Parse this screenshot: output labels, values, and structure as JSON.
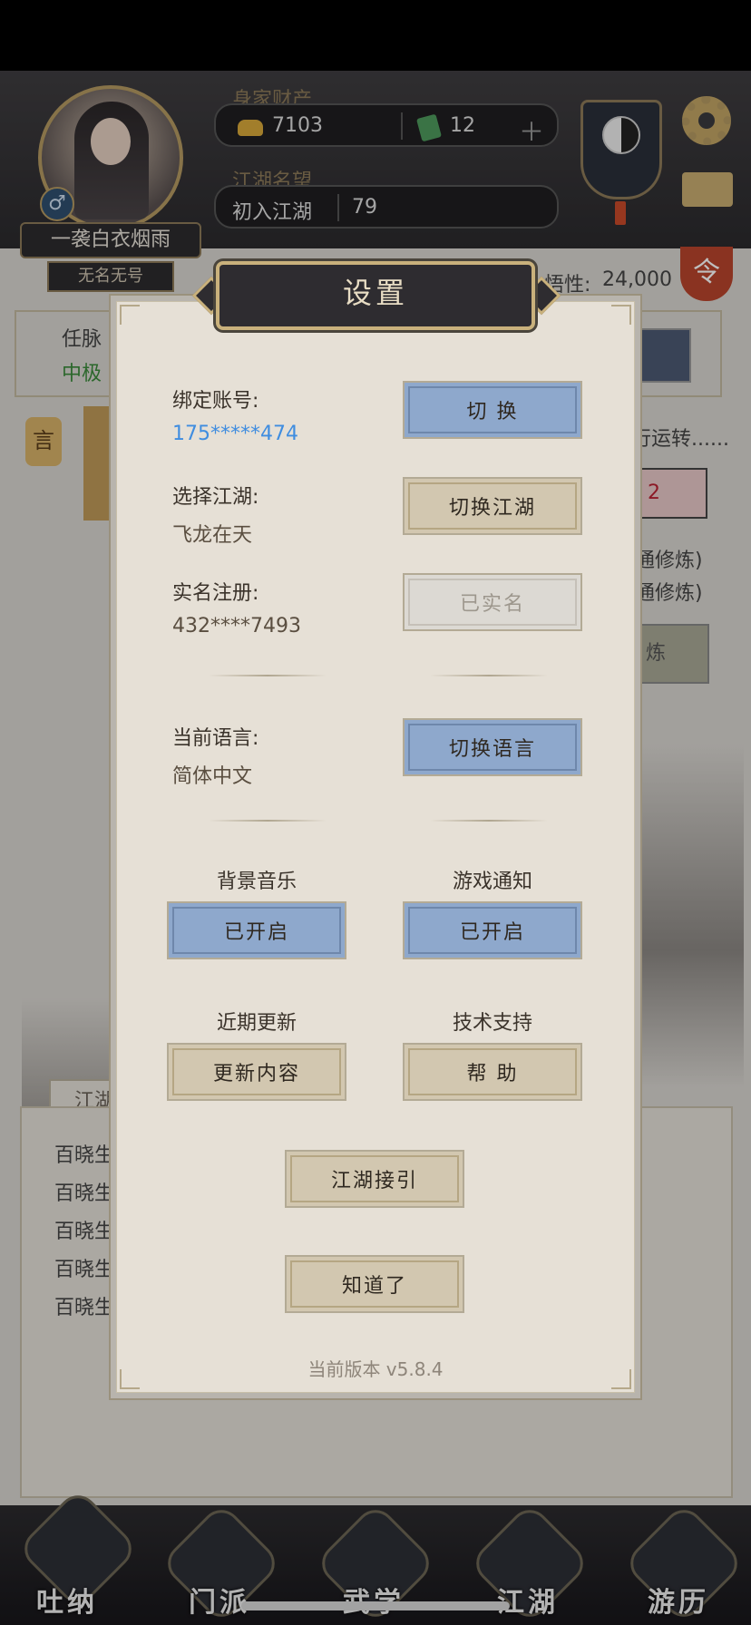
{
  "player": {
    "name": "一袭白衣烟雨",
    "title": "无名无号",
    "gender_symbol": "♂",
    "wealth_label": "身家财产",
    "gold": "7103",
    "jade": "12",
    "reputation_label": "江湖名望",
    "rank": "初入江湖",
    "reputation": "79",
    "insight_label": "悟性:",
    "insight_value": "24,000",
    "order_glyph": "令"
  },
  "background": {
    "meridian_label": "任脉",
    "meridian_sub": "中极",
    "speech_glyph": "言",
    "ops_text": "行运转......",
    "red_badge": "2",
    "practice_1": "通修炼)",
    "practice_2": "通修炼)",
    "practice_btn": "炼",
    "feed_tab": "江湖",
    "feed_items": [
      "百晓生",
      "百晓生",
      "百晓生",
      "百晓生",
      "百晓生"
    ]
  },
  "nav": {
    "items": [
      {
        "label": "吐纳"
      },
      {
        "label": "门派"
      },
      {
        "label": "武学"
      },
      {
        "label": "江湖"
      },
      {
        "label": "游历"
      }
    ]
  },
  "settings": {
    "title": "设置",
    "account": {
      "label": "绑定账号:",
      "value": "175*****474",
      "button": "切 换"
    },
    "server": {
      "label": "选择江湖:",
      "value": "飞龙在天",
      "button": "切换江湖"
    },
    "realname": {
      "label": "实名注册:",
      "value": "432****7493",
      "button": "已实名"
    },
    "language": {
      "label": "当前语言:",
      "value": "简体中文",
      "button": "切换语言"
    },
    "music": {
      "label": "背景音乐",
      "button": "已开启"
    },
    "notify": {
      "label": "游戏通知",
      "button": "已开启"
    },
    "updates": {
      "label": "近期更新",
      "button": "更新内容"
    },
    "support": {
      "label": "技术支持",
      "button": "帮 助"
    },
    "guide_button": "江湖接引",
    "ok_button": "知道了",
    "version": "当前版本 v5.8.4"
  },
  "colors": {
    "blue_button": "#8ea8cc",
    "tan_button": "#d2c7b0",
    "account_link": "#3f8de0",
    "panel": "#e6e0d6"
  }
}
